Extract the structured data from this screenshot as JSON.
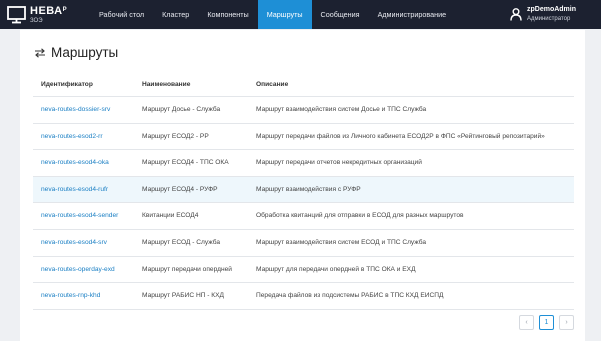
{
  "app": {
    "logo_name": "НЕВА",
    "logo_sup": "Р",
    "logo_sub": "ЗОЭ"
  },
  "nav": {
    "items": [
      {
        "label": "Рабочий стол"
      },
      {
        "label": "Кластер"
      },
      {
        "label": "Компоненты"
      },
      {
        "label": "Маршруты"
      },
      {
        "label": "Сообщения"
      },
      {
        "label": "Администрирование"
      }
    ],
    "active_index": 3
  },
  "user": {
    "name": "zpDemoAdmin",
    "role": "Администратор"
  },
  "page": {
    "title": "Маршруты"
  },
  "table": {
    "columns": [
      "Идентификатор",
      "Наименование",
      "Описание"
    ],
    "rows": [
      {
        "id": "neva-routes-dossier-srv",
        "name": "Маршрут Досье - Служба",
        "desc": "Маршрут взаимодействия систем Досье и ТПС Служба"
      },
      {
        "id": "neva-routes-esod2-rr",
        "name": "Маршрут ЕСОД2 - РР",
        "desc": "Маршрут передачи файлов из Личного кабинета ЕСОД2Р в ФПС «Рейтинговый репозитарий»"
      },
      {
        "id": "neva-routes-esod4-oka",
        "name": "Маршрут ЕСОД4 - ТПС ОКА",
        "desc": "Маршрут передачи отчетов некредитных организаций"
      },
      {
        "id": "neva-routes-esod4-rufr",
        "name": "Маршрут ЕСОД4 - РУФР",
        "desc": "Маршрут взаимодействия с РУФР"
      },
      {
        "id": "neva-routes-esod4-sender",
        "name": "Квитанции ЕСОД4",
        "desc": "Обработка квитанций для отправки в ЕСОД для разных маршрутов"
      },
      {
        "id": "neva-routes-esod4-srv",
        "name": "Маршрут ЕСОД - Служба",
        "desc": "Маршрут взаимодействия систем ЕСОД и ТПС Служба"
      },
      {
        "id": "neva-routes-operday-exd",
        "name": "Маршрут передачи опердней",
        "desc": "Маршрут для передачи опердней в ТПС ОКА и ЕХД"
      },
      {
        "id": "neva-routes-rnp-khd",
        "name": "Маршрут РАБИС НП - КХД",
        "desc": "Передача файлов из подсистемы РАБИС в ТПС КХД ЕИСПД"
      }
    ],
    "highlighted_row_index": 3
  },
  "pagination": {
    "prev": "‹",
    "current": "1",
    "next": "›"
  },
  "colors": {
    "topbar": "#1c2130",
    "accent": "#1e8fd6",
    "link": "#1a7fc4",
    "row_highlight": "#eef7fc"
  }
}
